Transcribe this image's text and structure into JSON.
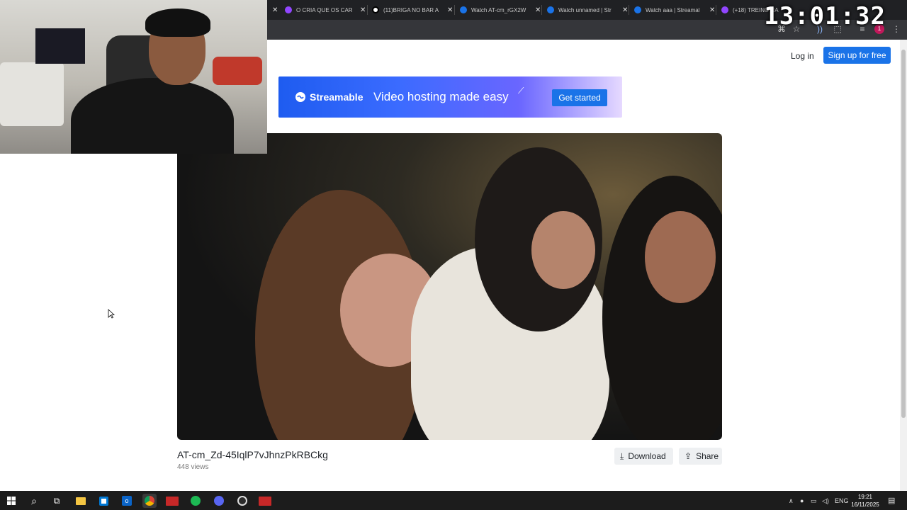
{
  "browser": {
    "tabs": [
      {
        "title": "O CRIA QUE OS CAR",
        "favicon_color": "#9146ff"
      },
      {
        "title": "(11)BRIGA NO BAR A",
        "favicon_color": "#ffffff"
      },
      {
        "title": "Watch AT-cm_rGX2W",
        "favicon_color": "#1a73e8"
      },
      {
        "title": "Watch unnamed | Str",
        "favicon_color": "#1a73e8"
      },
      {
        "title": "Watch aaa | Streamal",
        "favicon_color": "#1a73e8"
      },
      {
        "title": "(+18) TREINO NA",
        "favicon_color": "#9146ff"
      }
    ],
    "new_tab": "+",
    "profile_badge": "1"
  },
  "overlay_clock": "13:01:32",
  "header": {
    "login": "Log in",
    "signup": "Sign up for free"
  },
  "banner": {
    "brand": "Streamable",
    "tagline": "Video hosting made easy",
    "cta": "Get started"
  },
  "video": {
    "title": "AT-cm_Zd-45IqlP7vJhnzPkRBCkg",
    "views": "448 views",
    "download_label": "Download",
    "share_label": "Share"
  },
  "taskbar": {
    "apps": [
      "start-icon",
      "search-icon",
      "task-view-icon",
      "file-explorer-icon",
      "store-icon",
      "outlook-icon",
      "chrome-icon",
      "voicemeeter-icon",
      "spotify-icon",
      "discord-icon",
      "obs-icon",
      "voicemeeter-icon"
    ],
    "language": "ENG",
    "time": "19:21",
    "date": "16/11/2025"
  },
  "colors": {
    "accent": "#1a73e8",
    "chrome_bg": "#202124",
    "toolbar_bg": "#35363a",
    "taskbar_bg": "#1c1c1c"
  }
}
